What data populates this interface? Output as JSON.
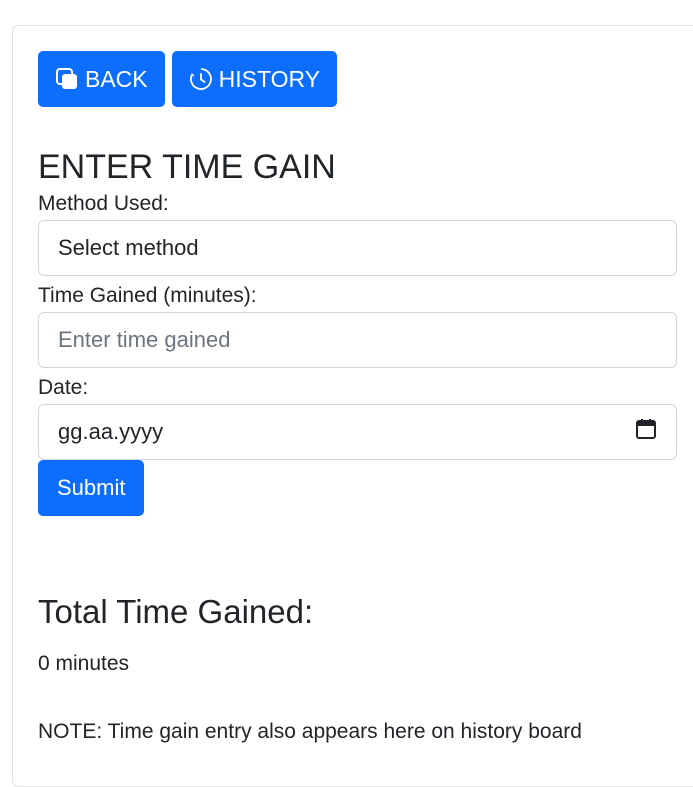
{
  "header": {
    "back_label": "BACK",
    "history_label": "HISTORY"
  },
  "form": {
    "title": "ENTER TIME GAIN",
    "method_label": "Method Used:",
    "method_value": "Select method",
    "time_label": "Time Gained (minutes):",
    "time_placeholder": "Enter time gained",
    "date_label": "Date:",
    "date_value": "gg.aa.yyyy",
    "submit_label": "Submit"
  },
  "summary": {
    "title": "Total Time Gained:",
    "value": "0 minutes",
    "note": "NOTE: Time gain entry also appears here on history board"
  },
  "icons": {
    "back": "window-copy-icon",
    "history": "clock-history-icon",
    "date": "calendar-icon"
  },
  "colors": {
    "primary": "#0d6efd",
    "text": "#212529",
    "placeholder": "#6c757d",
    "border": "#ced4da"
  }
}
